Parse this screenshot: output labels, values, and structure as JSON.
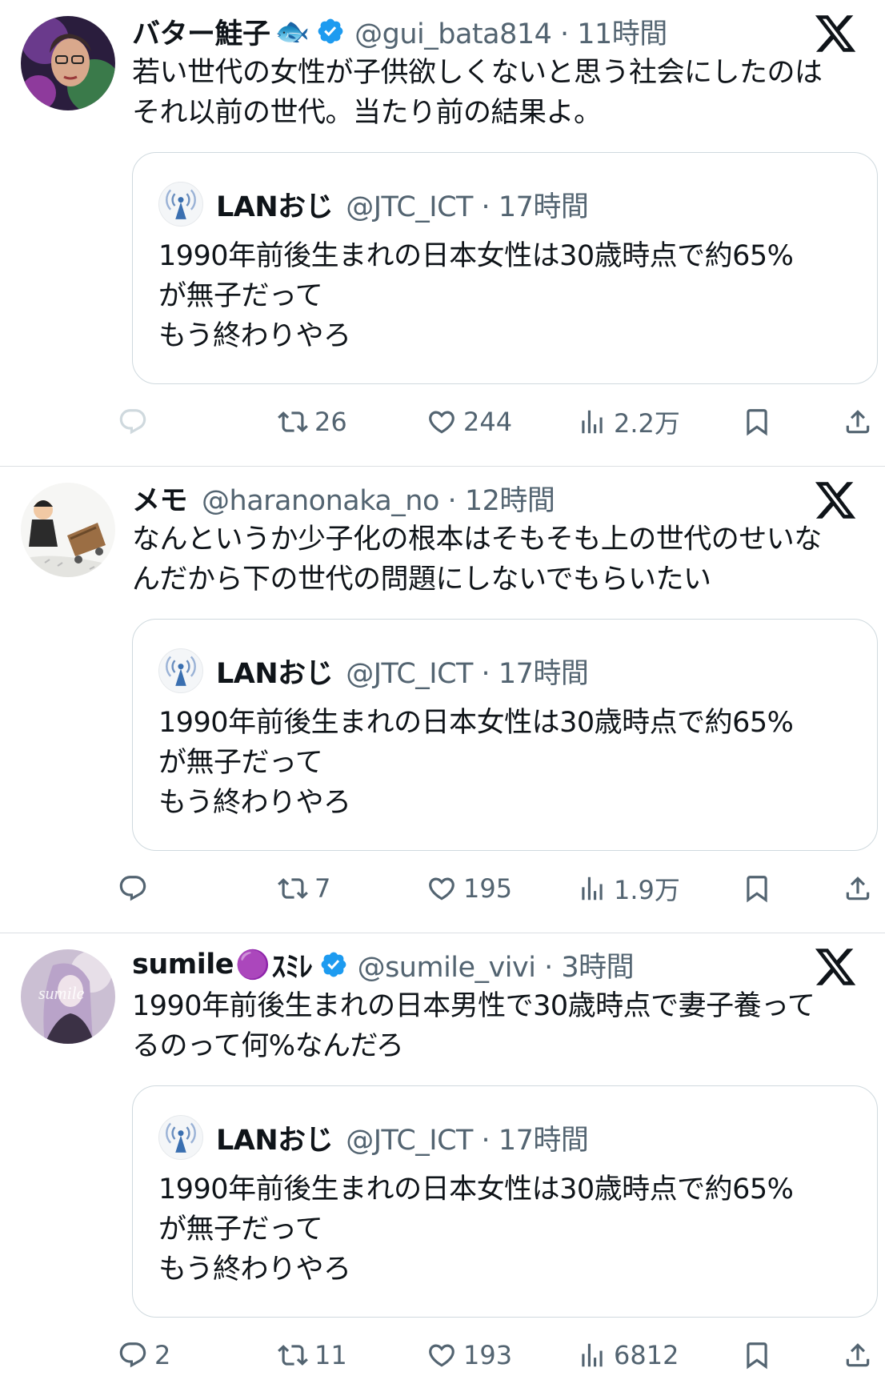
{
  "tweets": [
    {
      "name": "バター鮭子",
      "emoji": "🐟",
      "verified": true,
      "handle": "@gui_bata814",
      "time": "11時間",
      "text_lines": [
        "若い世代の女性が子供欲しくないと思う社会にしたのは",
        "それ以前の世代。当たり前の結果よ。"
      ],
      "quote": {
        "name": "LANおじ",
        "handle": "@JTC_ICT",
        "time": "17時間",
        "text_lines": [
          "1990年前後生まれの日本女性は30歳時点で約65%",
          "が無子だって",
          "もう終わりやろ"
        ]
      },
      "actions": {
        "replies": "",
        "retweets": "26",
        "likes": "244",
        "views": "2.2万"
      }
    },
    {
      "name": "メモ",
      "emoji": "",
      "verified": false,
      "handle": "@haranonaka_no",
      "time": "12時間",
      "text_lines": [
        "なんというか少子化の根本はそもそも上の世代のせいな",
        "んだから下の世代の問題にしないでもらいたい"
      ],
      "quote": {
        "name": "LANおじ",
        "handle": "@JTC_ICT",
        "time": "17時間",
        "text_lines": [
          "1990年前後生まれの日本女性は30歳時点で約65%",
          "が無子だって",
          "もう終わりやろ"
        ]
      },
      "actions": {
        "replies": "",
        "retweets": "7",
        "likes": "195",
        "views": "1.9万"
      }
    },
    {
      "name": "sumile",
      "emoji": "🟣",
      "name_suffix": "ｽﾐﾚ",
      "verified": true,
      "handle": "@sumile_vivi",
      "time": "3時間",
      "text_lines": [
        "1990年前後生まれの日本男性で30歳時点で妻子養って",
        "るのって何%なんだろ"
      ],
      "quote": {
        "name": "LANおじ",
        "handle": "@JTC_ICT",
        "time": "17時間",
        "text_lines": [
          "1990年前後生まれの日本女性は30歳時点で約65%",
          "が無子だって",
          "もう終わりやろ"
        ]
      },
      "actions": {
        "replies": "2",
        "retweets": "11",
        "likes": "193",
        "views": "6812"
      }
    }
  ],
  "icons": {
    "x_logo": "x-logo-icon",
    "verified": "verified-badge-icon",
    "reply": "reply-icon",
    "retweet": "retweet-icon",
    "like": "heart-icon",
    "views": "views-chart-icon",
    "bookmark": "bookmark-icon",
    "share": "share-icon",
    "quote_avatar": "antenna-icon"
  },
  "colors": {
    "verified": "#1d9bf0",
    "secondary_text": "#536471",
    "border": "#cfd9de"
  }
}
